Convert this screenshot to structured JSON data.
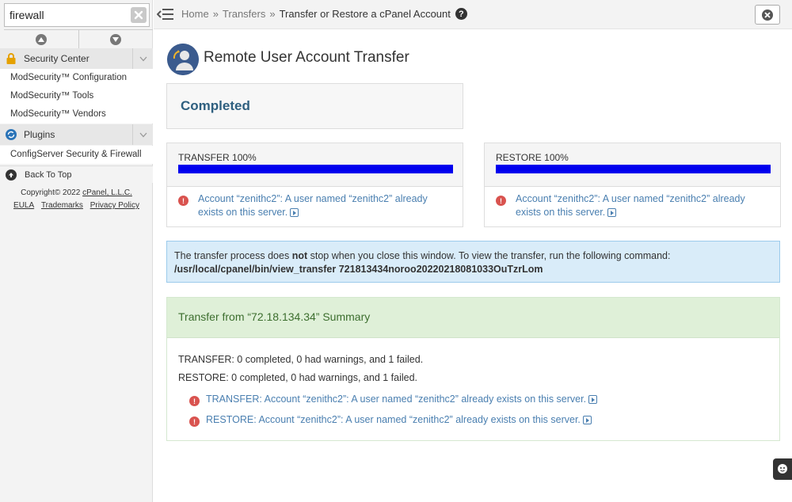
{
  "sidebar": {
    "search_value": "firewall",
    "sections": [
      {
        "label": "Security Center",
        "items": [
          "ModSecurity™ Configuration",
          "ModSecurity™ Tools",
          "ModSecurity™ Vendors"
        ]
      },
      {
        "label": "Plugins",
        "items": [
          "ConfigServer Security & Firewall"
        ]
      }
    ],
    "back_to_top": "Back To Top",
    "copyright_prefix": "Copyright© 2022",
    "copyright_link": "cPanel, L.L.C.",
    "legal_links": [
      "EULA",
      "Trademarks",
      "Privacy Policy"
    ]
  },
  "topbar": {
    "breadcrumb": [
      "Home",
      "Transfers"
    ],
    "breadcrumb_sep": "»",
    "current": "Transfer or Restore a cPanel Account",
    "help_label": "?"
  },
  "main": {
    "title": "Remote User Account Transfer",
    "status": "Completed",
    "transfer": {
      "label": "TRANSFER",
      "percent_label": "100%",
      "progress": 100,
      "error": "Account “zenithc2”: A user named “zenithc2” already exists on this server."
    },
    "restore": {
      "label": "RESTORE",
      "percent_label": "100%",
      "progress": 100,
      "error": "Account “zenithc2”: A user named “zenithc2” already exists on this server."
    },
    "info": {
      "text_before": "The transfer process does ",
      "text_bold": "not",
      "text_after": " stop when you close this window. To view the transfer, run the following command:",
      "command": "/usr/local/cpanel/bin/view_transfer 721813434noroo20220218081033OuTzrLom"
    },
    "summary": {
      "title": "Transfer from “72.18.134.34” Summary",
      "transfer_line": "TRANSFER: 0 completed, 0 had warnings, and 1 failed.",
      "restore_line": "RESTORE: 0 completed, 0 had warnings, and 1 failed.",
      "errors": [
        "TRANSFER: Account “zenithc2”: A user named “zenithc2” already exists on this server.",
        "RESTORE: Account “zenithc2”: A user named “zenithc2” already exists on this server."
      ]
    }
  },
  "colors": {
    "progress_fill": "#0000ee",
    "link": "#4a7fb0",
    "error_icon": "#d9534f",
    "status_text": "#2e5f7f"
  }
}
